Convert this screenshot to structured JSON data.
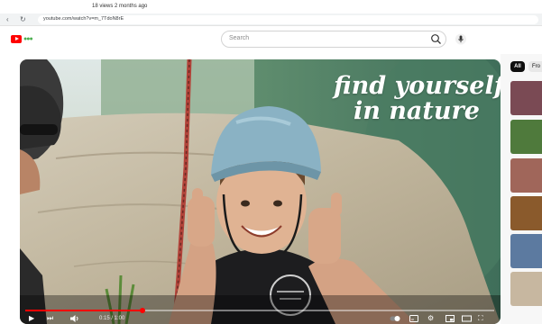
{
  "browser": {
    "tab_text": "18 views  2 months ago",
    "url": "youtube.com/watch?v=m_7TdoN8rE",
    "back_glyph": "‹",
    "reload_glyph": "↻"
  },
  "header": {
    "logo_name": "youtube-logo",
    "logo_dots": "●●●",
    "search_placeholder": "Search",
    "icons": [
      "search-icon",
      "mic-icon"
    ]
  },
  "video": {
    "overlay_line1": "find yourself",
    "overlay_line2": "in nature",
    "time": "0:15 / 1:00",
    "progress": 0.25,
    "controls": {
      "play": "▶",
      "next": "⏭",
      "settings": "⚙",
      "fullscreen": "⛶"
    }
  },
  "rail": {
    "chip_all": "All",
    "chip_next": "Fro",
    "thumbnails": [
      {
        "color": "#7a4a54"
      },
      {
        "color": "#4f7a3c"
      },
      {
        "color": "#a0665a"
      },
      {
        "color": "#8a5a2c"
      },
      {
        "color": "#5c7aa0"
      },
      {
        "color": "#c7b7a0"
      }
    ]
  },
  "colors": {
    "accent": "#ff0000",
    "chip_active": "#0f0f0f",
    "helmet": "#8ab2c4",
    "shirt": "#1d1d1f"
  }
}
